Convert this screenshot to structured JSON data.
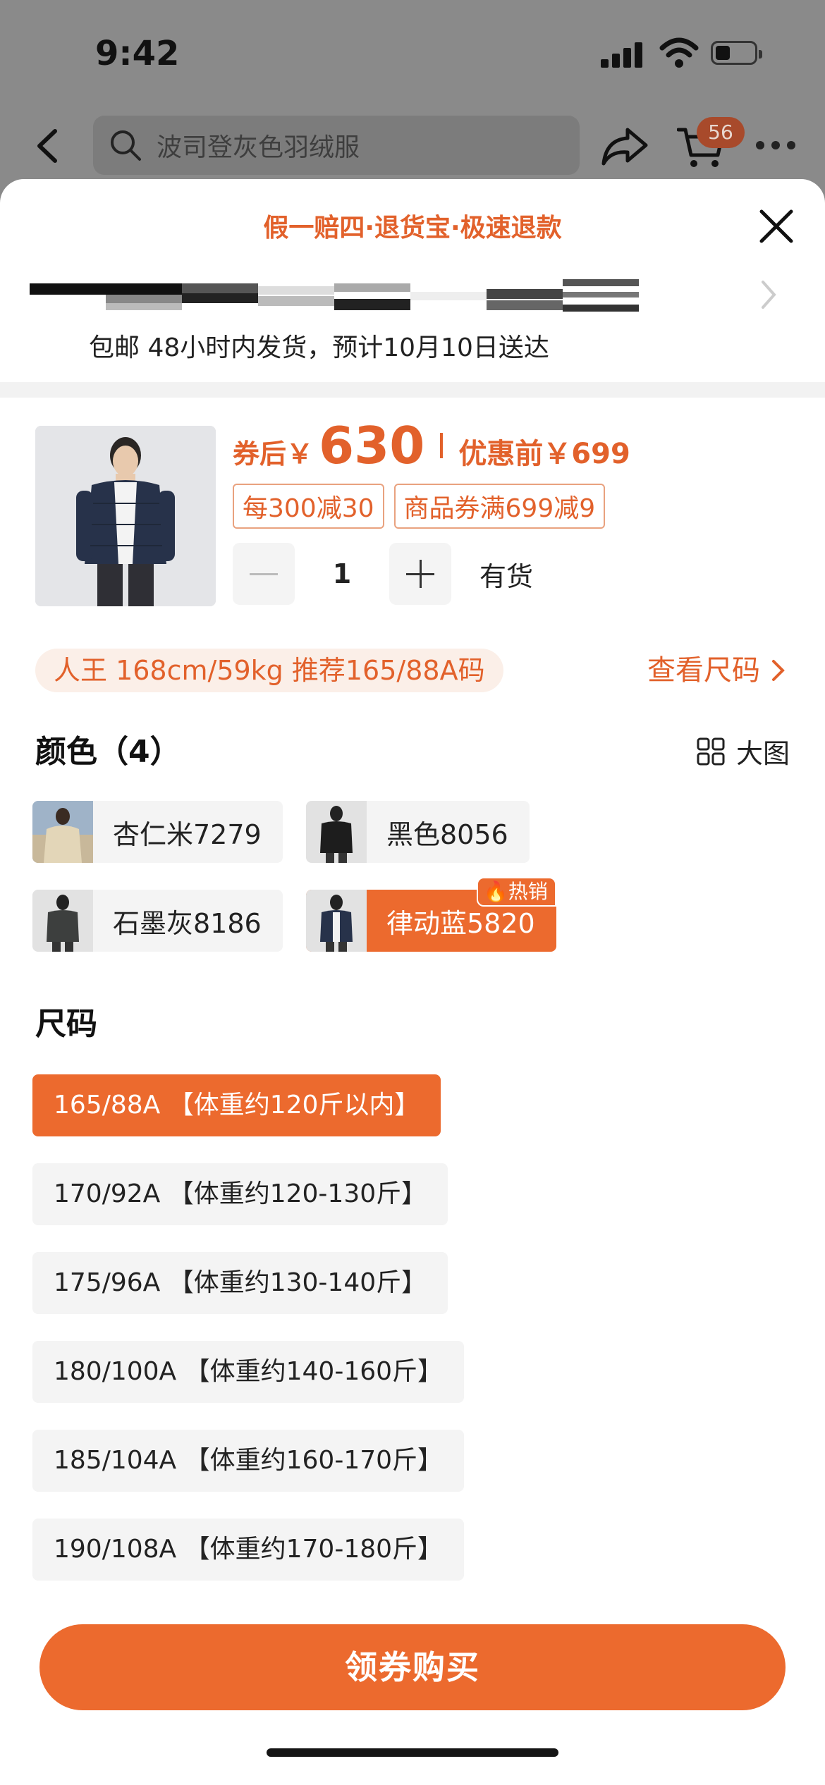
{
  "status_bar": {
    "time": "9:42"
  },
  "header": {
    "search_placeholder": "波司登灰色羽绒服",
    "cart_count": "56"
  },
  "sheet": {
    "guarantee_text": "假一赔四·退货宝·极速退款",
    "delivery_text": "包邮 48小时内发货，预计10月10日送达",
    "price": {
      "prefix": "券后￥",
      "value": "630",
      "before": "优惠前￥699"
    },
    "coupons": [
      "每300减30",
      "商品券满699减9"
    ],
    "quantity": "1",
    "stock": "有货",
    "recommendation": "人王 168cm/59kg 推荐165/88A码",
    "size_chart_link": "查看尺码",
    "color_title": "颜色（4）",
    "big_view_label": "大图",
    "colors": [
      {
        "label": "杏仁米7279",
        "selected": false
      },
      {
        "label": "黑色8056",
        "selected": false
      },
      {
        "label": "石墨灰8186",
        "selected": false
      },
      {
        "label": "律动蓝5820",
        "selected": true,
        "badge": "热销"
      }
    ],
    "size_title": "尺码",
    "sizes": [
      {
        "label": "165/88A 【体重约120斤以内】",
        "selected": true
      },
      {
        "label": "170/92A 【体重约120-130斤】",
        "selected": false
      },
      {
        "label": "175/96A 【体重约130-140斤】",
        "selected": false
      },
      {
        "label": "180/100A 【体重约140-160斤】",
        "selected": false
      },
      {
        "label": "185/104A 【体重约160-170斤】",
        "selected": false
      },
      {
        "label": "190/108A 【体重约170-180斤】",
        "selected": false
      }
    ],
    "buy_button": "领券购买",
    "accent_color": "#EC6A2E"
  }
}
